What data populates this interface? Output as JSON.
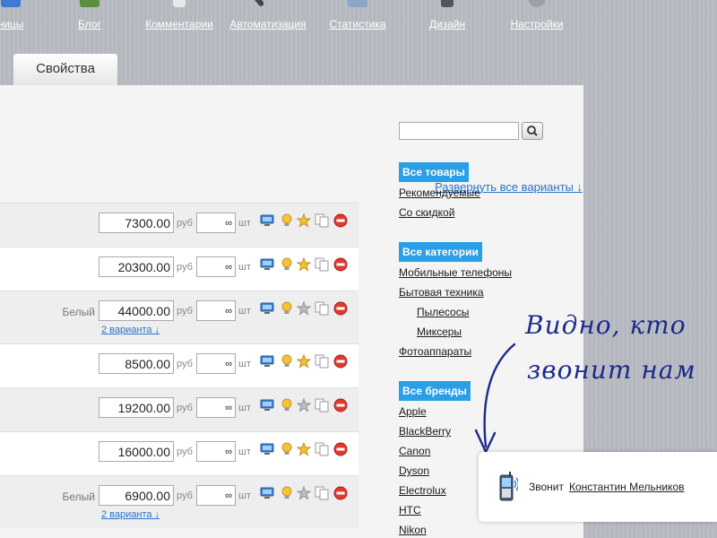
{
  "nav": {
    "items": [
      {
        "label": "ницы",
        "icon": "pages-icon"
      },
      {
        "label": "Блог",
        "icon": "blog-icon"
      },
      {
        "label": "Комментарии",
        "icon": "comments-icon"
      },
      {
        "label": "Автоматизация",
        "icon": "automation-icon"
      },
      {
        "label": "Статистика",
        "icon": "statistics-icon"
      },
      {
        "label": "Дизайн",
        "icon": "design-icon"
      },
      {
        "label": "Настройки",
        "icon": "settings-icon"
      }
    ]
  },
  "tab": {
    "label": "Свойства"
  },
  "main": {
    "expand_all": "Развернуть все варианты ↓",
    "rows": [
      {
        "variant": "",
        "price": "7300.00",
        "qty": "∞",
        "starred": true,
        "variants_link": ""
      },
      {
        "variant": "",
        "price": "20300.00",
        "qty": "∞",
        "starred": true,
        "variants_link": ""
      },
      {
        "variant": "Белый",
        "price": "44000.00",
        "qty": "∞",
        "starred": false,
        "variants_link": "2 варианта ↓"
      },
      {
        "variant": "",
        "price": "8500.00",
        "qty": "∞",
        "starred": true,
        "variants_link": ""
      },
      {
        "variant": "",
        "price": "19200.00",
        "qty": "∞",
        "starred": false,
        "variants_link": ""
      },
      {
        "variant": "",
        "price": "16000.00",
        "qty": "∞",
        "starred": true,
        "variants_link": ""
      },
      {
        "variant": "Белый",
        "price": "6900.00",
        "qty": "∞",
        "starred": false,
        "variants_link": "2 варианта ↓"
      }
    ],
    "currency": "руб",
    "unit": "шт"
  },
  "sidebar": {
    "search_placeholder": "",
    "products_filter": {
      "badge": "Все товары",
      "links": [
        "Рекомендуемые",
        "Со скидкой"
      ]
    },
    "categories": {
      "badge": "Все категории",
      "links": [
        {
          "label": "Мобильные телефоны",
          "sub": false
        },
        {
          "label": "Бытовая техника",
          "sub": false
        },
        {
          "label": "Пылесосы",
          "sub": true
        },
        {
          "label": "Миксеры",
          "sub": true
        },
        {
          "label": "Фотоаппараты",
          "sub": false
        }
      ]
    },
    "brands": {
      "badge": "Все бренды",
      "links": [
        "Apple",
        "BlackBerry",
        "Canon",
        "Dyson",
        "Electrolux",
        "HTC",
        "Nikon"
      ]
    }
  },
  "annotation": {
    "line1": "Видно, кто",
    "line2": "звонит нам"
  },
  "call_popup": {
    "prefix": "Звонит",
    "caller": "Константин Мельников",
    "icon": "phone-icon"
  },
  "colors": {
    "accent": "#2a9ee6",
    "link": "#2a72c8",
    "annotation": "#1a2a8a"
  }
}
